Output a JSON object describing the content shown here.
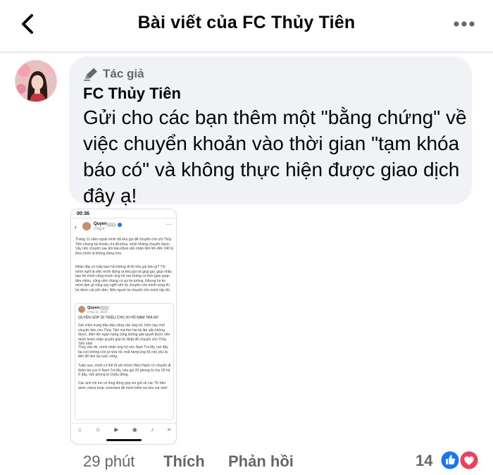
{
  "header": {
    "title": "Bài viết của FC Thủy Tiên",
    "back_icon": "chevron-left-icon",
    "more_icon": "more-horizontal-icon"
  },
  "comment": {
    "author_badge": "Tác giả",
    "author_badge_icon": "pen-icon",
    "author_name": "FC Thủy Tiên",
    "text": "Gửi cho các bạn thêm một \"bằng chứng\" về việc chuyển khoản vào thời gian \"tạm khóa báo có\" và không thực hiện được giao dịch đây ạ!",
    "bubble_color": "#f0f2f5"
  },
  "attachment": {
    "status_time": "00:36",
    "post_author": "Quyen",
    "post_date": "3 thg 9 ·",
    "post_body_1": "Tháng 11 năm ngoái mình đã kêu gọi để chuyển cho chị Thủy Tiên nhưng tài khoản chị đã khoá, mình không chuyển được. Vậy nên chuyện sau khi báo khoá vẫn nhận tiền lên đến 340 tỷ theo mình là không đúng nha.",
    "post_body_2": "Nhân đây có mấy bạn hỏi không đi thì kêu gọi làm gì? Thì mình nghĩ là việc mình đứng ra kêu gọi nó giúp gọi, giúp nhắc bạn bè mình cũng muốn ủng hộ mà không có thời gian quan tâm nhiều, cũng nhờ chúng có sự tin tưởng. Nhưng họ tin mình làm gì cũng suy nghĩ nên họ chuyển cho mình xong thì họ được cái yên tâm. Nên người ta chuyển cho mình vậy đó.",
    "quote_author": "Quyen",
    "quote_date": "8 thg 11, 2020 ·",
    "quote_headline": "QUYÊN GÓP 20 TRIỆU CHO 20 HỘ  NAM TRÀ MY",
    "quote_body_1": "Giờ miền trung đầu đâu cũng cần ủng hộ, hôm nay mới chuyển tiền cho Thủy Tiên mà thứ hai tài lần vẫn không được, điện lên ngân hàng cũng không giải quyết được nên mình hoàn nhận quyên góp từ Nhật để chuyển cho Thủy Tiên nhé!",
    "quote_body_2": "Thay vào đó, mình nhận ủng hộ cho Nam Trà My, nơi đây bà con không còn gì nữa rồi, mất hàng ủng hộ chủ yếu là tiền để làm lại cuộc sống.",
    "quote_body_3": "Tuần sau, mình có thể đi với nhóm Hiếu Hạnh có chuyến đi thăm bà con ở Nam Trà My, kêu gọi 20 phong bì cho 20 hộ ở đây, mỗi phong bì 1triệu đồng.",
    "quote_body_4": "Các anh chị em có lòng đóng góp xin gửi về các TK bên dưới, inbox hoặc comment để mình kiểm tra kèo xót nhé!"
  },
  "footer": {
    "time": "29 phút",
    "like_label": "Thích",
    "reply_label": "Phản hồi",
    "reaction_count": "14",
    "reaction_icons": [
      "like-icon",
      "love-icon"
    ],
    "like_color": "#1877f2",
    "love_color": "#f33e58"
  }
}
